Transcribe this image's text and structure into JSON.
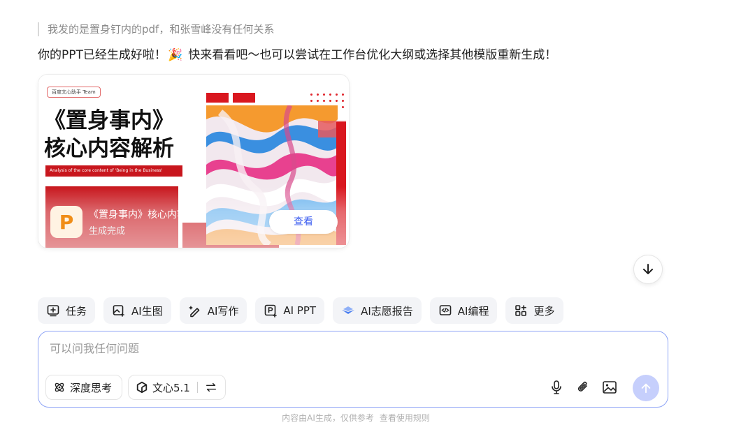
{
  "chat": {
    "quoted_message": "我发的是置身钉内的pdf，和张雪峰没有任何关系",
    "reply_before_emoji": "你的PPT已经生成好啦！",
    "reply_emoji": "🎉",
    "reply_after_emoji": " 快来看看吧～也可以尝试在工作台优化大纲或选择其他模版重新生成！"
  },
  "ppt_card": {
    "slide_tag": "百度文心助手 Team",
    "slide_title_line1": "《置身事内》",
    "slide_title_line2": "核心内容解析",
    "slide_subtitle": "Analysis of the core content of 'Being in the Business'",
    "file_icon_letter": "P",
    "file_name": "《置身事内》核心内容解析",
    "file_status": "生成完成",
    "view_button": "查看"
  },
  "scroll_button_icon": "arrow-down-icon",
  "quick_actions": [
    {
      "label": "任务",
      "icon": "task-icon"
    },
    {
      "label": "AI生图",
      "icon": "image-gen-icon"
    },
    {
      "label": "AI写作",
      "icon": "pen-icon"
    },
    {
      "label": "AI PPT",
      "icon": "ppt-icon"
    },
    {
      "label": "AI志愿报告",
      "icon": "report-icon"
    },
    {
      "label": "AI编程",
      "icon": "code-icon"
    },
    {
      "label": "更多",
      "icon": "grid-icon"
    }
  ],
  "composer": {
    "placeholder": "可以问我任何问题",
    "deep_think_label": "深度思考",
    "model_label": "文心5.1"
  },
  "footer": {
    "disclaimer": "内容由AI生成，仅供参考",
    "rules_link": "查看使用规则"
  },
  "colors": {
    "accent": "#3b5cf0",
    "composer_border": "#8ea4f6",
    "send_disabled": "#c6cffc",
    "slide_red": "#c8161d"
  }
}
